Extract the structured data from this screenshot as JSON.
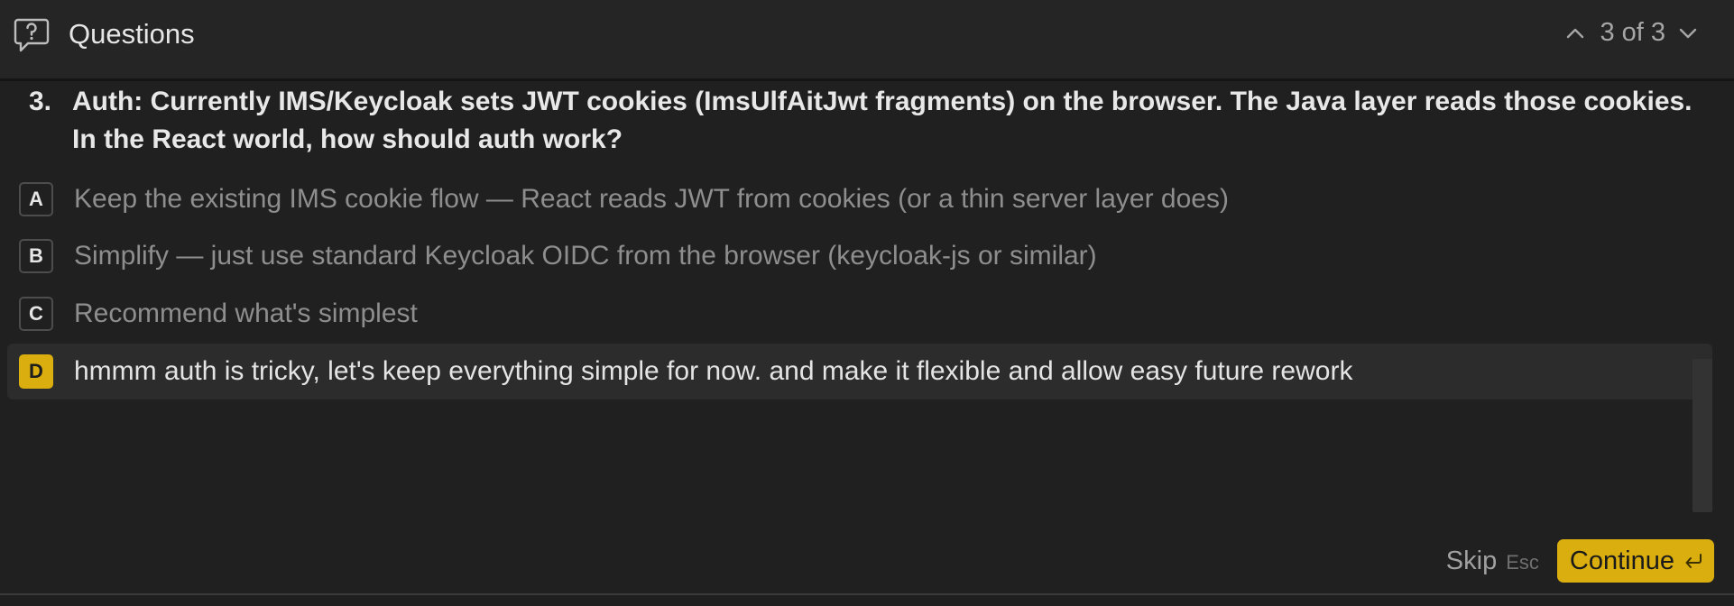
{
  "header": {
    "title": "Questions",
    "pager_text": "3 of 3"
  },
  "question": {
    "number": "3.",
    "text": "Auth: Currently IMS/Keycloak sets JWT cookies (ImsUlfAitJwt fragments) on the browser. The Java layer reads those cookies. In the React world, how should auth work?"
  },
  "options": [
    {
      "key": "A",
      "label": "Keep the existing IMS cookie flow — React reads JWT from cookies (or a thin server layer does)"
    },
    {
      "key": "B",
      "label": "Simplify — just use standard Keycloak OIDC from the browser (keycloak-js or similar)"
    },
    {
      "key": "C",
      "label": "Recommend what's simplest"
    },
    {
      "key": "D",
      "label": "hmmm auth is tricky, let's keep everything simple for now. and make it flexible and allow easy future rework",
      "selected": true
    }
  ],
  "footer": {
    "skip_label": "Skip",
    "skip_shortcut": "Esc",
    "continue_label": "Continue"
  },
  "colors": {
    "accent": "#d9ae0e",
    "background": "#202020"
  },
  "icons": {
    "header": "question-bubble-icon",
    "prev": "chevron-up-icon",
    "next": "chevron-down-icon",
    "continue": "enter-key-icon"
  }
}
